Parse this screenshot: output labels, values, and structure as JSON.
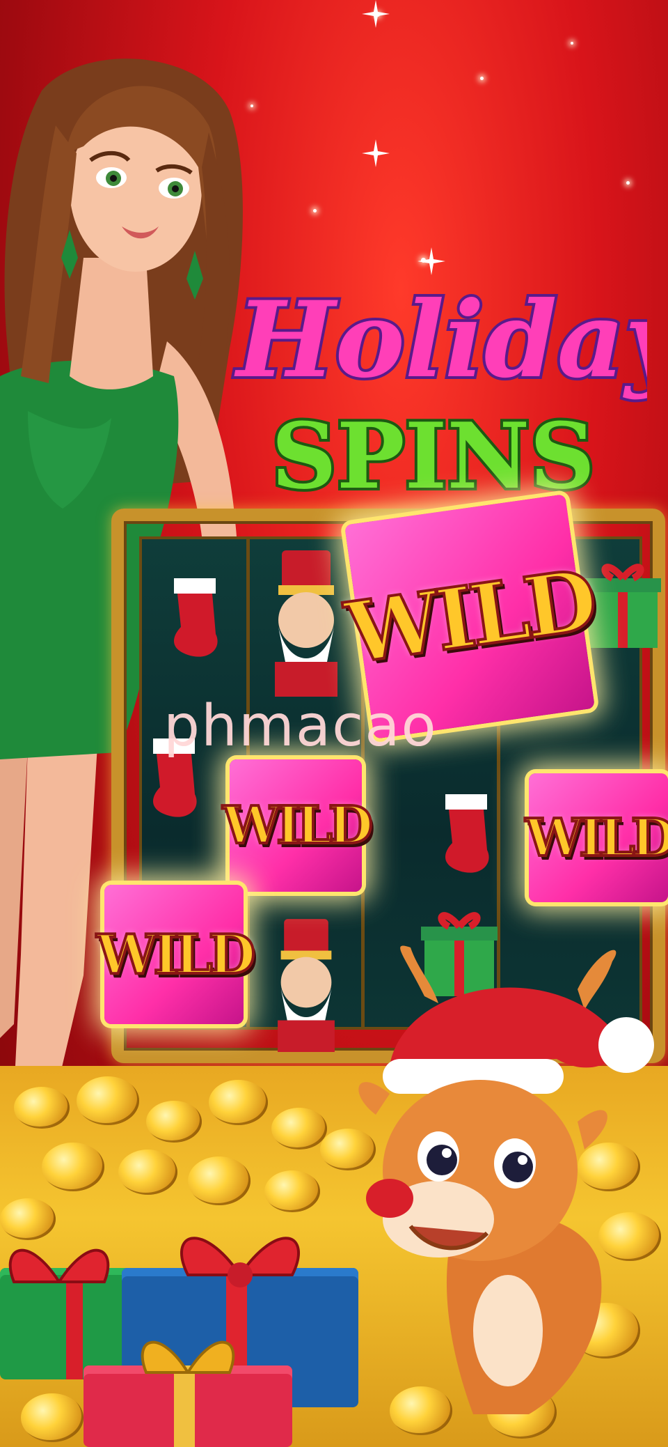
{
  "game": {
    "title_line1": "Holiday",
    "title_line2": "SPINS",
    "wild_label": "WILD",
    "watermark": "phmacao"
  },
  "colors": {
    "background": "#d8141a",
    "dress": "#1f8a3a",
    "wild_tile": "#ff2fa8",
    "wild_text": "#ffc72a",
    "coin": "#ffd23a",
    "frame_gold": "#c8922b",
    "title_pink": "#ff3fb8",
    "title_green": "#6de030"
  },
  "symbols": [
    "stocking-icon",
    "nutcracker-icon",
    "gift-icon",
    "wild-icon"
  ]
}
